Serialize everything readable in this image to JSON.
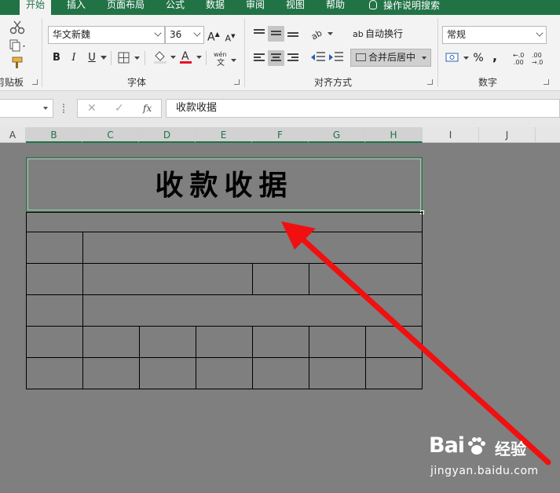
{
  "ribbon_tabs": [
    "开始",
    "插入",
    "页面布局",
    "公式",
    "数据",
    "审阅",
    "视图",
    "帮助",
    "操作说明搜索"
  ],
  "ribbon": {
    "font_name": "华文新魏",
    "font_size": "36",
    "wrap_text": "自动换行",
    "merge_center": "合并后居中",
    "number_format": "常规",
    "clipboard_group": "剪贴板",
    "font_group": "字体",
    "alignment_group": "对齐方式",
    "number_group": "数字",
    "bold": "B",
    "italic": "I",
    "underline": "U",
    "grow_font": "A",
    "shrink_font": "A",
    "percent": "%",
    "comma": ","
  },
  "formula_bar": {
    "cancel": "✕",
    "enter": "✓",
    "fx": "fx",
    "content": "收款收据"
  },
  "columns": [
    "A",
    "B",
    "C",
    "D",
    "E",
    "F",
    "G",
    "H",
    "I",
    "J"
  ],
  "selected_columns": [
    "B",
    "C",
    "D",
    "E",
    "F",
    "G",
    "H"
  ],
  "sheet": {
    "title_cell_text": "收款收据"
  },
  "watermark": {
    "logo": "Bai",
    "logo_suffix": "经验",
    "url": "jingyan.baidu.com"
  },
  "colors": {
    "excel_green": "#217346",
    "arrow_red": "#f01010",
    "sheet_bg": "#7f7f7f",
    "font_color_bar": "#e81123"
  }
}
